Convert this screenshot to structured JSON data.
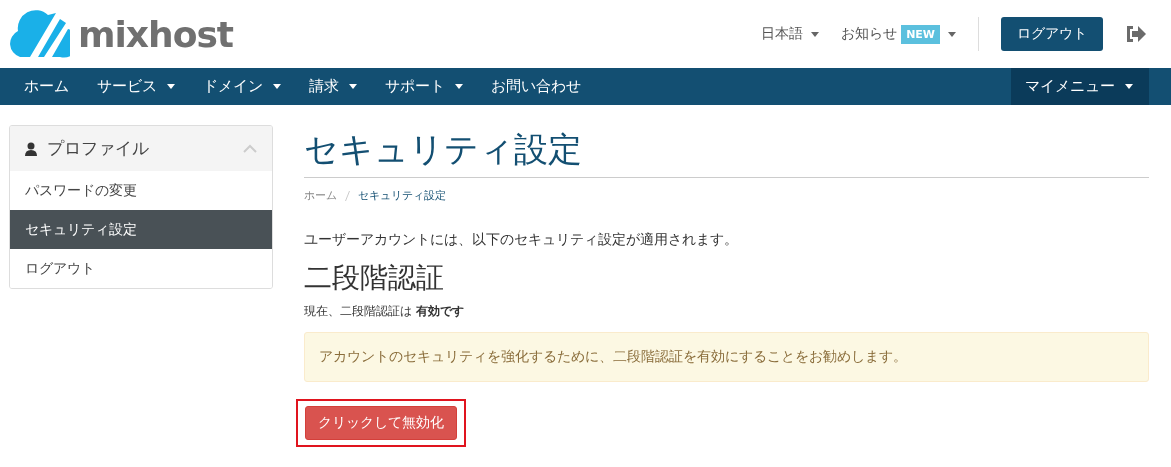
{
  "header": {
    "logo_text": "mixhost",
    "language": "日本語",
    "notices": "お知らせ",
    "notices_badge": "NEW",
    "logout_button": "ログアウト"
  },
  "nav": {
    "items": [
      {
        "label": "ホーム",
        "dropdown": false
      },
      {
        "label": "サービス",
        "dropdown": true
      },
      {
        "label": "ドメイン",
        "dropdown": true
      },
      {
        "label": "請求",
        "dropdown": true
      },
      {
        "label": "サポート",
        "dropdown": true
      },
      {
        "label": "お問い合わせ",
        "dropdown": false
      }
    ],
    "right_menu": {
      "label": "マイメニュー",
      "dropdown": true
    }
  },
  "sidebar": {
    "title": "プロファイル",
    "expanded": true,
    "items": [
      {
        "label": "パスワードの変更",
        "selected": false
      },
      {
        "label": "セキュリティ設定",
        "selected": true
      },
      {
        "label": "ログアウト",
        "selected": false
      }
    ]
  },
  "content": {
    "title": "セキュリティ設定",
    "breadcrumb": [
      "ホーム",
      "セキュリティ設定"
    ],
    "intro": "ユーザーアカウントには、以下のセキュリティ設定が適用されます。",
    "section_title": "二段階認証",
    "status": "現在、二段階認証は **有効です**",
    "alert": "アカウントのセキュリティを強化するために、二段階認証を有効にすることをお勧めします。",
    "button": {
      "label": "クリックして無効化",
      "highlighted": true
    }
  }
}
